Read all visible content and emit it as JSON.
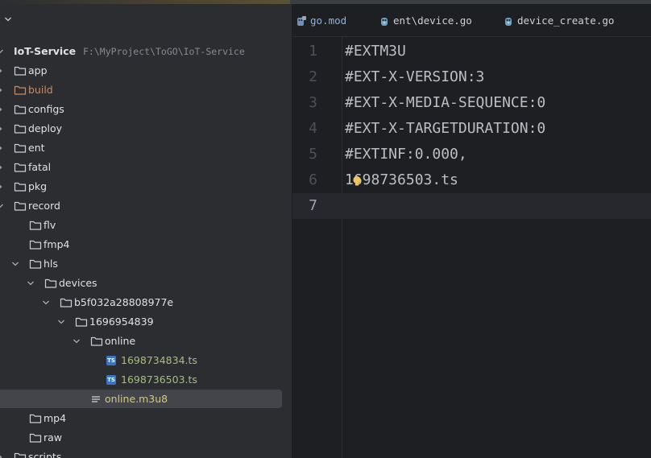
{
  "project": {
    "root": {
      "name": "IoT-Service",
      "path": "F:\\MyProject\\ToGO\\IoT-Service"
    },
    "items": [
      {
        "label": "app",
        "depth": 0,
        "expanded": false,
        "type": "folder",
        "style": "normal"
      },
      {
        "label": "build",
        "depth": 0,
        "expanded": false,
        "type": "folder",
        "style": "excluded"
      },
      {
        "label": "configs",
        "depth": 0,
        "expanded": false,
        "type": "folder",
        "style": "normal"
      },
      {
        "label": "deploy",
        "depth": 0,
        "expanded": false,
        "type": "folder",
        "style": "normal"
      },
      {
        "label": "ent",
        "depth": 0,
        "expanded": false,
        "type": "folder",
        "style": "normal"
      },
      {
        "label": "fatal",
        "depth": 0,
        "expanded": false,
        "type": "folder",
        "style": "normal"
      },
      {
        "label": "pkg",
        "depth": 0,
        "expanded": false,
        "type": "folder",
        "style": "normal"
      },
      {
        "label": "record",
        "depth": 0,
        "expanded": true,
        "type": "folder",
        "style": "normal"
      },
      {
        "label": "flv",
        "depth": 1,
        "expanded": null,
        "type": "folder",
        "style": "normal"
      },
      {
        "label": "fmp4",
        "depth": 1,
        "expanded": null,
        "type": "folder",
        "style": "normal"
      },
      {
        "label": "hls",
        "depth": 1,
        "expanded": true,
        "type": "folder",
        "style": "normal"
      },
      {
        "label": "devices",
        "depth": 2,
        "expanded": true,
        "type": "folder",
        "style": "normal"
      },
      {
        "label": "b5f032a28808977e",
        "depth": 3,
        "expanded": true,
        "type": "folder",
        "style": "normal"
      },
      {
        "label": "1696954839",
        "depth": 4,
        "expanded": true,
        "type": "folder",
        "style": "normal"
      },
      {
        "label": "online",
        "depth": 5,
        "expanded": true,
        "type": "folder",
        "style": "normal"
      },
      {
        "label": "1698734834.ts",
        "depth": 6,
        "expanded": null,
        "type": "ts",
        "style": "green"
      },
      {
        "label": "1698736503.ts",
        "depth": 6,
        "expanded": null,
        "type": "ts",
        "style": "green"
      },
      {
        "label": "online.m3u8",
        "depth": 5,
        "expanded": null,
        "type": "text",
        "style": "file",
        "selected": true
      },
      {
        "label": "mp4",
        "depth": 1,
        "expanded": null,
        "type": "folder",
        "style": "normal"
      },
      {
        "label": "raw",
        "depth": 1,
        "expanded": null,
        "type": "folder",
        "style": "normal"
      },
      {
        "label": "scripts",
        "depth": 0,
        "expanded": false,
        "type": "folder",
        "style": "normal"
      }
    ]
  },
  "tabs": [
    {
      "label": "go.mod",
      "icon": "go-mod-icon",
      "kind": "mod"
    },
    {
      "label": "ent\\device.go",
      "icon": "gopher-icon",
      "kind": "go"
    },
    {
      "label": "device_create.go",
      "icon": "gopher-icon",
      "kind": "go"
    }
  ],
  "editor": {
    "lines": [
      {
        "num": "1",
        "text": "#EXTM3U"
      },
      {
        "num": "2",
        "text": "#EXT-X-VERSION:3"
      },
      {
        "num": "3",
        "text": "#EXT-X-MEDIA-SEQUENCE:0"
      },
      {
        "num": "4",
        "text": "#EXT-X-TARGETDURATION:0"
      },
      {
        "num": "5",
        "text": "#EXTINF:0.000,"
      },
      {
        "num": "6",
        "text": "1698736503.ts"
      },
      {
        "num": "7",
        "text": ""
      }
    ],
    "current_line": 7
  },
  "colors": {
    "panel_bg": "#2b2d30",
    "editor_bg": "#1e1f22",
    "excluded_folder": "#d08c60",
    "ts_file": "#a9bf77",
    "text_file": "#d5c97b",
    "bulb": "#f2c55c"
  }
}
